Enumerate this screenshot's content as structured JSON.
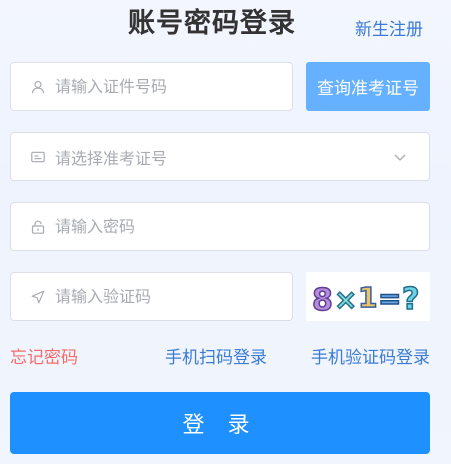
{
  "header": {
    "title": "账号密码登录",
    "register_link": "新生注册"
  },
  "form": {
    "id_field": {
      "placeholder": "请输入证件号码",
      "value": "",
      "icon": "user-icon"
    },
    "query_button": "查询准考证号",
    "ticket_select": {
      "placeholder": "请选择准考证号",
      "icon": "id-card-icon",
      "dropdown_icon": "chevron-down-icon"
    },
    "password_field": {
      "placeholder": "请输入密码",
      "value": "",
      "icon": "lock-icon"
    },
    "captcha_field": {
      "placeholder": "请输入验证码",
      "value": "",
      "icon": "location-arrow-icon"
    },
    "captcha_image": {
      "text": "8×1=?"
    }
  },
  "links": {
    "forgot_password": "忘记密码",
    "qr_login": "手机扫码登录",
    "sms_login": "手机验证码登录"
  },
  "login_button": "登 录",
  "colors": {
    "primary": "#1e90ff",
    "primary_light": "#66b1ff",
    "link_blue": "#3a7bd5",
    "danger": "#f56c6c",
    "placeholder_gray": "#a8abb2",
    "border_gray": "#dcdfe6"
  }
}
